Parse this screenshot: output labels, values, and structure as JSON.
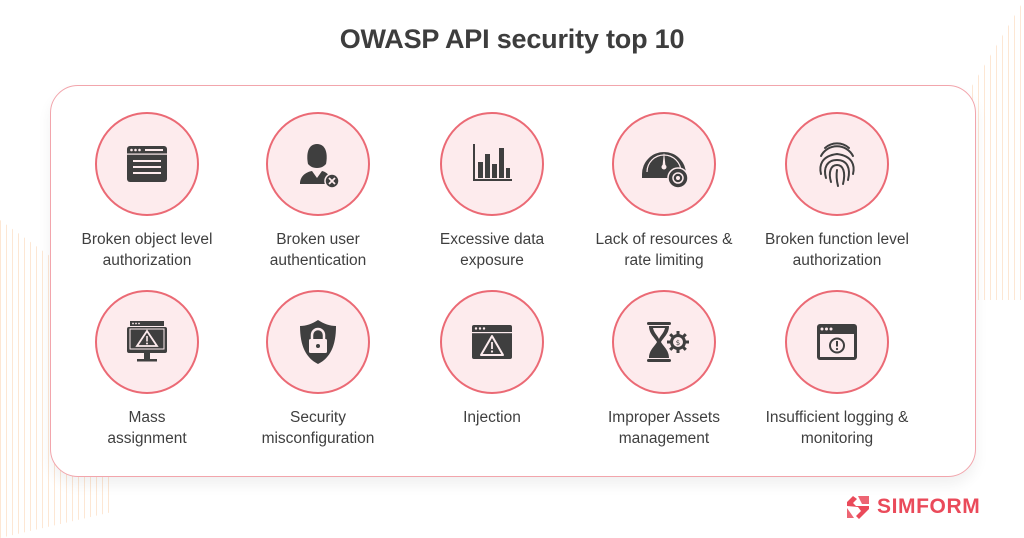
{
  "title": "OWASP API security top 10",
  "colors": {
    "accent": "#eb6a75",
    "circle_fill": "#fdebed",
    "icon": "#3f3f3f",
    "brand": "#ea4a5a",
    "text": "#3f3f3f"
  },
  "items": [
    {
      "line1": "Broken object level",
      "line2": "authorization",
      "icon": "browser-window-icon"
    },
    {
      "line1": "Broken user",
      "line2": "authentication",
      "icon": "user-denied-icon"
    },
    {
      "line1": "Excessive data",
      "line2": "exposure",
      "icon": "bar-chart-icon"
    },
    {
      "line1": "Lack of resources &",
      "line2": "rate limiting",
      "icon": "speedometer-gear-icon"
    },
    {
      "line1": "Broken function level",
      "line2": "authorization",
      "icon": "fingerprint-icon"
    },
    {
      "line1": "Mass",
      "line2": "assignment",
      "icon": "monitor-warning-icon"
    },
    {
      "line1": "Security",
      "line2": "misconfiguration",
      "icon": "shield-lock-icon"
    },
    {
      "line1": "Injection",
      "line2": "",
      "icon": "browser-warning-icon"
    },
    {
      "line1": "Improper Assets",
      "line2": "management",
      "icon": "hourglass-gear-icon"
    },
    {
      "line1": "Insufficient logging &",
      "line2": "monitoring",
      "icon": "browser-alert-icon"
    }
  ],
  "brand": {
    "name": "SIMFORM",
    "icon": "simform-logo-icon"
  }
}
